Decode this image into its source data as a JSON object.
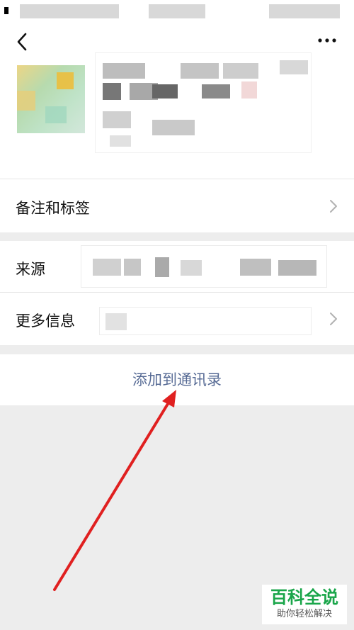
{
  "profile": {
    "actions": {
      "back_icon": "chevron-left-icon",
      "more_icon": "more-dots-icon"
    }
  },
  "rows": {
    "remarks_label": "备注和标签",
    "source_label": "来源",
    "more_info_label": "更多信息"
  },
  "primary_action": {
    "label": "添加到通讯录"
  },
  "watermark": {
    "main": "百科全说",
    "sub": "助你轻松解决"
  },
  "colors": {
    "link": "#576b95",
    "background": "#ededed",
    "arrow": "#e02020",
    "watermark_green": "#1aa64a"
  }
}
